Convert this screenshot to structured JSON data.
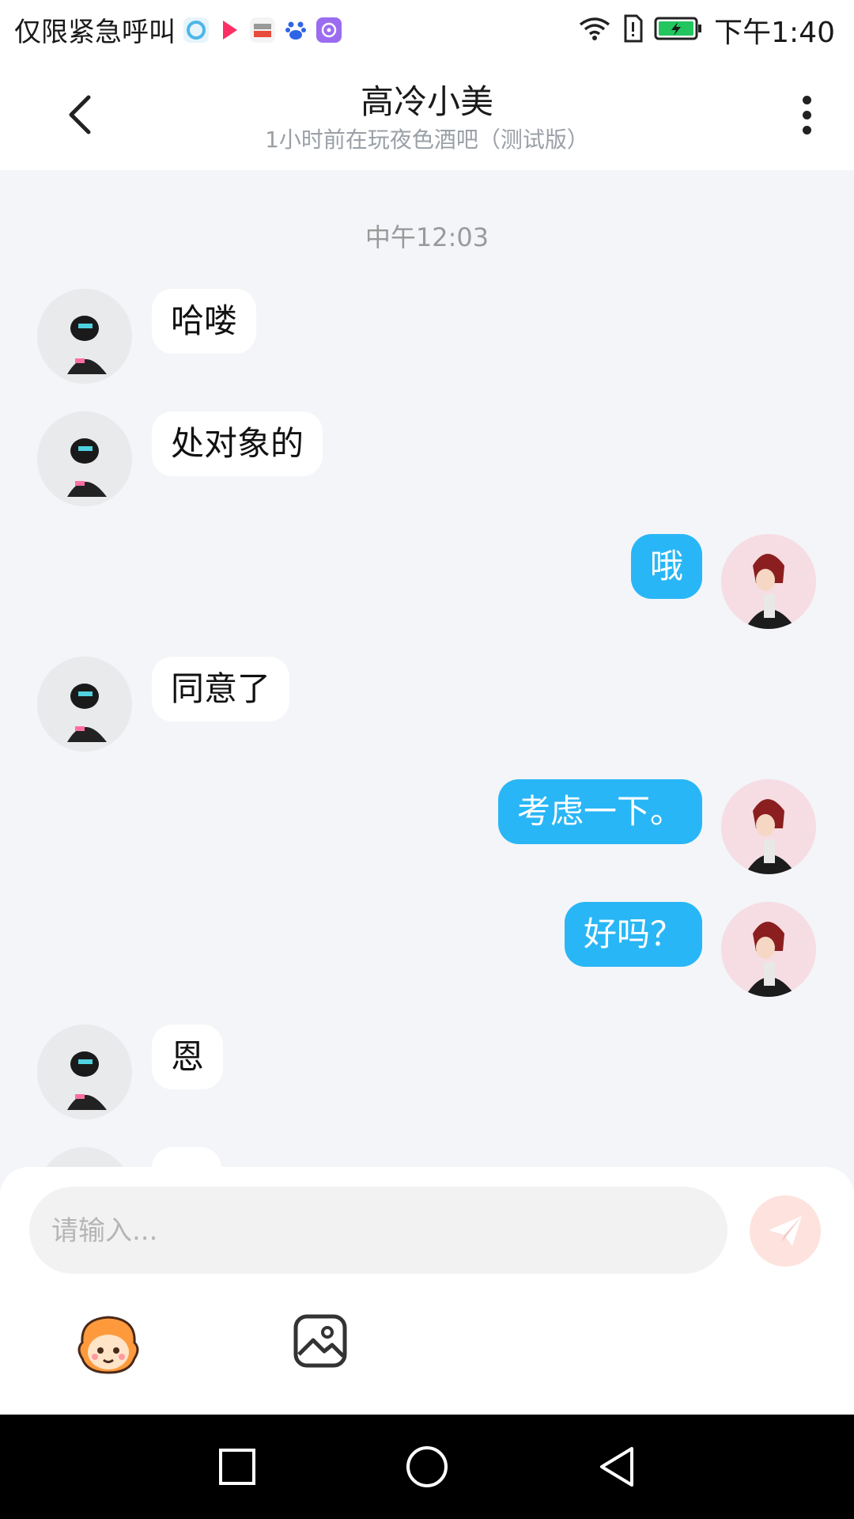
{
  "status_bar": {
    "carrier_text": "仅限紧急呼叫",
    "time": "下午1:40",
    "icons": [
      "browser-icon",
      "youku-icon",
      "sohu-video-icon",
      "baidu-icon",
      "music-icon",
      "wifi-icon",
      "sim-alert-icon",
      "battery-icon"
    ],
    "app_icon_labels": [
      "YOUKU",
      "搜狐视频",
      "du"
    ],
    "battery_color": "#22c55e"
  },
  "header": {
    "title": "高冷小美",
    "subtitle": "1小时前在玩夜色酒吧（测试版）"
  },
  "chat": {
    "timestamp": "中午12:03",
    "messages": [
      {
        "side": "in",
        "text": "哈喽"
      },
      {
        "side": "in",
        "text": "处对象的"
      },
      {
        "side": "out",
        "text": "哦"
      },
      {
        "side": "in",
        "text": "同意了"
      },
      {
        "side": "out",
        "text": "考虑一下。"
      },
      {
        "side": "out",
        "text": "好吗？"
      },
      {
        "side": "in",
        "text": "恩"
      }
    ]
  },
  "composer": {
    "placeholder": "请输入..."
  },
  "colors": {
    "accent_outgoing": "#29b6f6",
    "incoming_bubble": "#ffffff",
    "chat_background": "#f3f5f8",
    "send_button_bg": "#fde2de"
  }
}
